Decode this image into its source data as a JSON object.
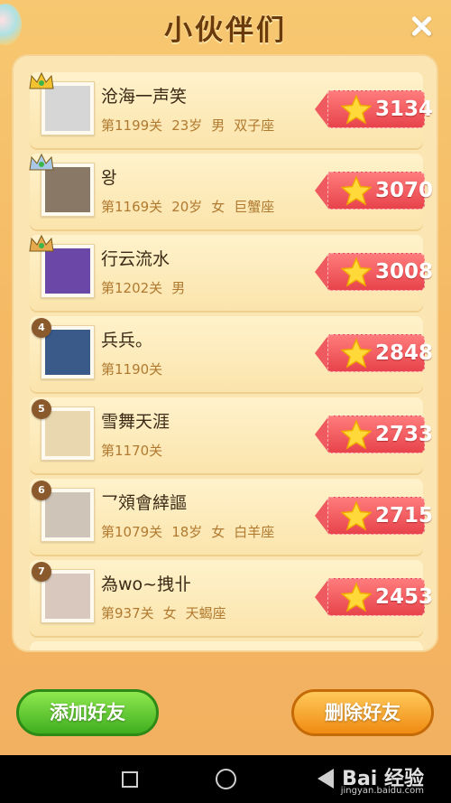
{
  "header": {
    "title": "小伙伴们"
  },
  "friends": [
    {
      "rank": "1",
      "name": "沧海一声笑",
      "level": "第1199关",
      "age": "23岁",
      "gender": "男",
      "sign": "双子座",
      "score": "3134",
      "crown_color": "#f2c230",
      "avatar_bg": "#d6d6d6"
    },
    {
      "rank": "2",
      "name": "왕",
      "level": "第1169关",
      "age": "20岁",
      "gender": "女",
      "sign": "巨蟹座",
      "score": "3070",
      "crown_color": "#a9c7e6",
      "avatar_bg": "#8a7866"
    },
    {
      "rank": "3",
      "name": "行云流水",
      "level": "第1202关",
      "age": "",
      "gender": "男",
      "sign": "",
      "score": "3008",
      "crown_color": "#e6a94e",
      "avatar_bg": "#6b47a8"
    },
    {
      "rank": "4",
      "name": "兵兵。",
      "level": "第1190关",
      "age": "",
      "gender": "",
      "sign": "",
      "score": "2848",
      "crown_color": "",
      "avatar_bg": "#3a5a8a"
    },
    {
      "rank": "5",
      "name": "雪舞天涯",
      "level": "第1170关",
      "age": "",
      "gender": "",
      "sign": "",
      "score": "2733",
      "crown_color": "",
      "avatar_bg": "#e9d7b0"
    },
    {
      "rank": "6",
      "name": "乛頝會緈謳",
      "level": "第1079关",
      "age": "18岁",
      "gender": "女",
      "sign": "白羊座",
      "score": "2715",
      "crown_color": "",
      "avatar_bg": "#cfc4b8"
    },
    {
      "rank": "7",
      "name": "為wo~拽卝",
      "level": "第937关",
      "age": "",
      "gender": "女",
      "sign": "天蝎座",
      "score": "2453",
      "crown_color": "",
      "avatar_bg": "#d9c8bd"
    }
  ],
  "buttons": {
    "add": "添加好友",
    "delete": "删除好友"
  },
  "watermark": {
    "brand": "Bai 经验",
    "url": "jingyan.baidu.com"
  }
}
